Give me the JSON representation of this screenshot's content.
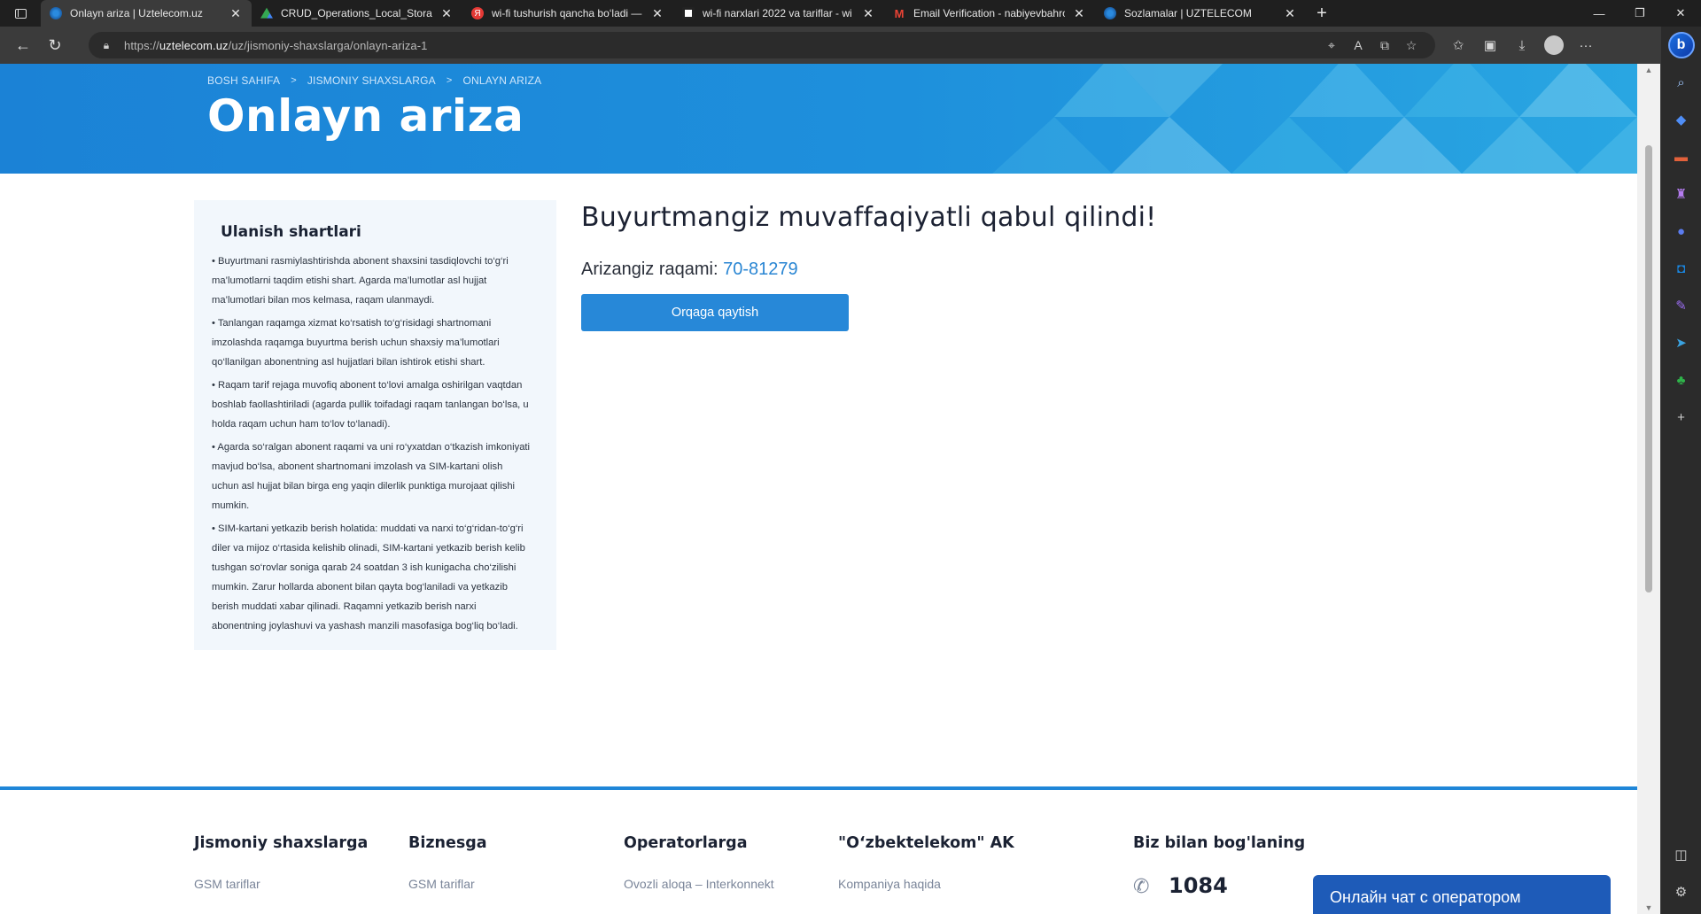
{
  "browser": {
    "tabs": [
      {
        "title": "Onlayn ariza | Uztelecom.uz",
        "favicon_color": "#2a8be0",
        "active": true
      },
      {
        "title": "CRUD_Operations_Local_Storage",
        "favicon_color": "#34a853",
        "active": false
      },
      {
        "title": "wi-fi tushurish qancha bo‘ladi —",
        "favicon_color": "#e53935",
        "active": false
      },
      {
        "title": "wi-fi narxlari 2022 va tariflar - wi",
        "favicon_color": "#ffffff",
        "active": false
      },
      {
        "title": "Email Verification - nabiyevbahro",
        "favicon_color": "#ea4335",
        "active": false
      },
      {
        "title": "Sozlamalar | UZTELECOM",
        "favicon_color": "#2a8be0",
        "active": false
      }
    ],
    "url_prefix": "https://",
    "url_host": "uztelecom.uz",
    "url_path": "/uz/jismoniy-shaxslarga/onlayn-ariza-1"
  },
  "breadcrumb": [
    "BOSH SAHIFA",
    "JISMONIY SHAXSLARGA",
    "ONLAYN ARIZA"
  ],
  "page_title": "Onlayn ariza",
  "conditions": {
    "title": "Ulanish shartlari",
    "items": [
      "• Buyurtmani rasmiylashtirishda abonent shaxsini tasdiqlovchi to‘g‘ri ma’lumotlarni taqdim etishi shart. Agarda ma’lumotlar asl hujjat ma’lumotlari bilan mos kelmasa, raqam ulanmaydi.",
      "• Tanlangan raqamga xizmat ko‘rsatish to‘g‘risidagi shartnomani imzolashda raqamga buyurtma berish uchun shaxsiy ma’lumotlari qo‘llanilgan abonentning asl hujjatlari bilan ishtirok etishi shart.",
      "• Raqam tarif rejaga muvofiq abonent to‘lovi amalga oshirilgan vaqtdan boshlab faollashtiriladi (agarda pullik toifadagi raqam tanlangan bo‘lsa, u holda raqam uchun ham to‘lov to‘lanadi).",
      "• Agarda so‘ralgan abonent raqami va uni ro‘yxatdan o‘tkazish imkoniyati mavjud bo‘lsa, abonent shartnomani imzolash va SIM-kartani olish uchun asl hujjat bilan birga eng yaqin dilerlik punktiga murojaat qilishi mumkin.",
      "• SIM-kartani yetkazib berish holatida: muddati va narxi to‘g‘ridan-to‘g‘ri diler va mijoz o‘rtasida kelishib olinadi, SIM-kartani yetkazib berish kelib tushgan so‘rovlar soniga qarab 24 soatdan 3 ish kunigacha cho‘zilishi mumkin. Zarur hollarda abonent bilan qayta bog‘laniladi va yetkazib berish muddati xabar qilinadi. Raqamni yetkazib berish narxi abonentning joylashuvi va yashash manzili masofasiga bog‘liq bo‘ladi."
    ]
  },
  "result": {
    "heading": "Buyurtmangiz muvaffaqiyatli qabul qilindi!",
    "order_label": "Arizangiz raqami:",
    "order_number": "70-81279",
    "back_button": "Orqaga qaytish"
  },
  "footer": {
    "columns": [
      {
        "title": "Jismoniy shaxslarga",
        "link": "GSM tariflar"
      },
      {
        "title": "Biznesga",
        "link": "GSM tariflar"
      },
      {
        "title": "Operatorlarga",
        "link": "Ovozli aloqa – Interkonnekt"
      },
      {
        "title": "\"O‘zbektelekom\" AK",
        "link": "Kompaniya haqida"
      }
    ],
    "contact_title": "Biz bilan bog'laning",
    "phone": "1084"
  },
  "chat_button": "Онлайн чат с оператором",
  "colors": {
    "brand_blue": "#1f86d8",
    "button_blue": "#2788d8",
    "chat_blue": "#1e5bb8"
  }
}
